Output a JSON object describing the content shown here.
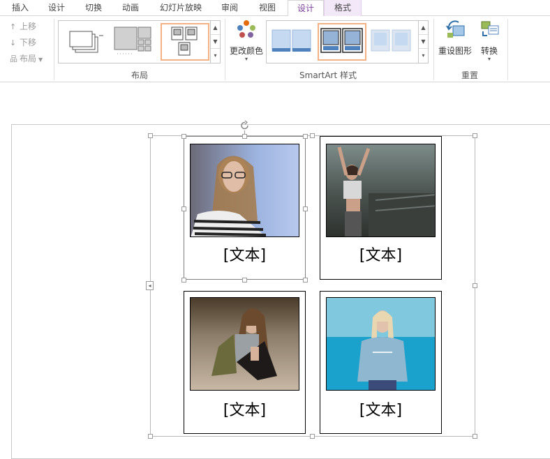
{
  "tabs": [
    {
      "label": "插入",
      "active": false
    },
    {
      "label": "设计",
      "active": false
    },
    {
      "label": "切换",
      "active": false
    },
    {
      "label": "动画",
      "active": false
    },
    {
      "label": "幻灯片放映",
      "active": false
    },
    {
      "label": "审阅",
      "active": false
    },
    {
      "label": "视图",
      "active": false
    },
    {
      "label": "设计",
      "active": true
    },
    {
      "label": "格式",
      "active": false
    }
  ],
  "ribbon": {
    "create_graphic": {
      "move_up": "上移",
      "move_down": "下移",
      "layout": "布局"
    },
    "layouts": {
      "label": "布局"
    },
    "change_colors": "更改颜色",
    "styles": {
      "label": "SmartArt 样式"
    },
    "reset": {
      "label": "重置",
      "reset_graphic": "重设图形",
      "convert": "转换"
    }
  },
  "smartart": {
    "cards": [
      {
        "text": "[文本]",
        "photo": "woman-with-glasses-photo"
      },
      {
        "text": "[文本]",
        "photo": "woman-stretching-photo"
      },
      {
        "text": "[文本]",
        "photo": "woman-sitting-photo"
      },
      {
        "text": "[文本]",
        "photo": "woman-blue-sweater-photo"
      }
    ]
  },
  "colors": {
    "accent_tab": "#7a3f9a",
    "context_tab_bg": "#f3e8f8",
    "gallery_selected": "#f4b183",
    "style_blue": "#4f81bd"
  }
}
